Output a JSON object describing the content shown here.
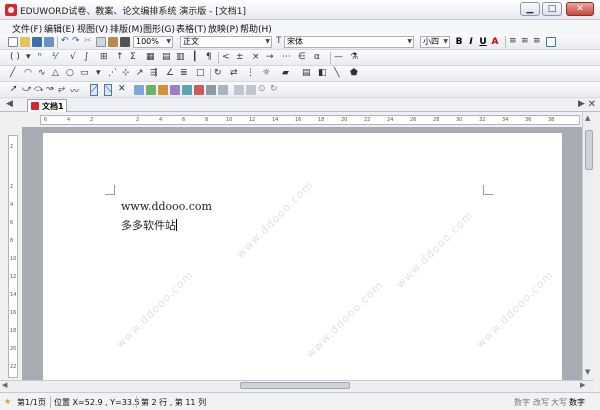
{
  "window": {
    "title": "EDUWORD试卷、教案、论文编排系统 演示版 - [文档1]",
    "controls": {
      "minimize": "▁",
      "maximize": "□",
      "close": "✕"
    }
  },
  "menu": [
    "文件(F)",
    "编辑(E)",
    "视图(V)",
    "排版(M)",
    "图形(G)",
    "表格(T)",
    "放映(P)",
    "帮助(H)"
  ],
  "toolbar": {
    "zoom": "100%",
    "style": "正文",
    "font": "宋体",
    "font_size": "小四",
    "bold": "B",
    "italic": "I",
    "underline": "U",
    "font_color": "A"
  },
  "tabs": {
    "active_doc": "文档1",
    "close_label": "✕",
    "prev": "◀",
    "next": "▶"
  },
  "ruler": {
    "horizontal": [
      "6",
      "4",
      "2",
      "",
      "2",
      "4",
      "6",
      "8",
      "10",
      "12",
      "14",
      "16",
      "18",
      "20",
      "22",
      "24",
      "26",
      "28",
      "30",
      "32",
      "34",
      "36",
      "38"
    ],
    "vertical": [
      "2",
      "",
      "2",
      "4",
      "6",
      "8",
      "10",
      "12",
      "14",
      "16",
      "18",
      "20",
      "22"
    ]
  },
  "document": {
    "lines": [
      "www.ddooo.com",
      "多多软件站"
    ]
  },
  "watermark": {
    "text": "www.ddooo.com"
  },
  "status": {
    "page": "第1/1页",
    "position": "位置 X=52.9 , Y=33.5",
    "line_col": "第 2 行 , 第 11 列",
    "indicators": {
      "num": "数字",
      "overwrite": "改写",
      "caps": "大写",
      "num2": "数字"
    }
  }
}
